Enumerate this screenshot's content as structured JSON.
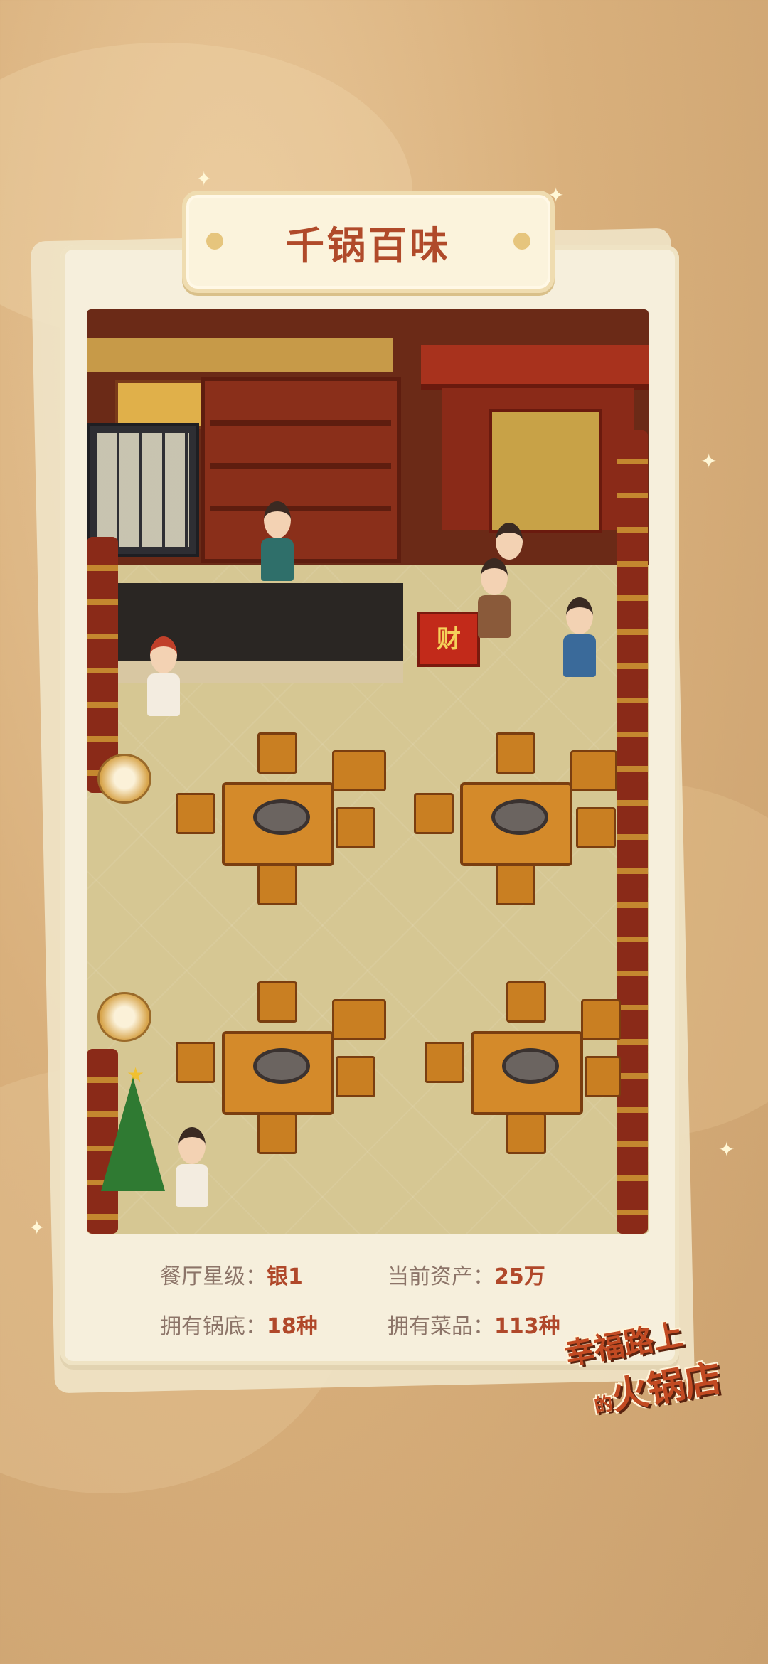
{
  "title": "千锅百味",
  "stats": {
    "rating_label": "餐厅星级：",
    "rating_value": "银1",
    "assets_label": "当前资产：",
    "assets_value": "25万",
    "bases_label": "拥有锅底：",
    "bases_value": "18种",
    "dishes_label": "拥有菜品：",
    "dishes_value": "113种"
  },
  "logo": {
    "line1": "幸福路上",
    "line2_small": "的",
    "line2": "火锅店"
  },
  "scene": {
    "sign_char": "财"
  },
  "colors": {
    "accent": "#b0482a",
    "card": "#f6efdc",
    "background": "#d9b07c"
  }
}
